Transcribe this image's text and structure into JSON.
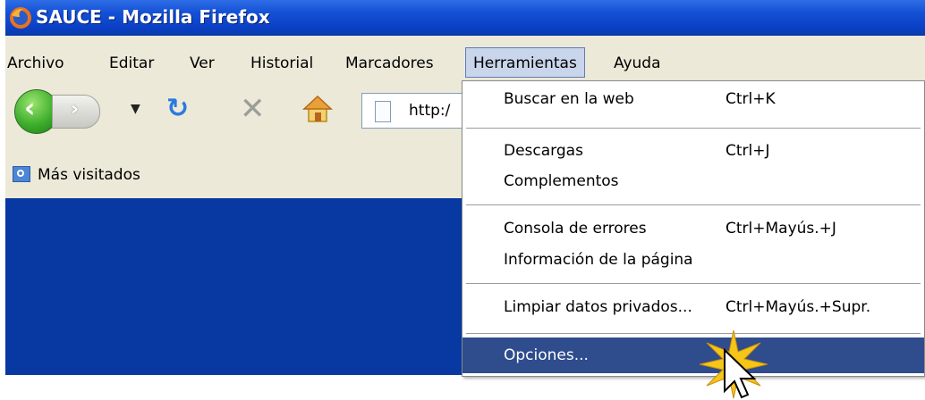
{
  "window": {
    "title": "SAUCE - Mozilla Firefox"
  },
  "menubar": {
    "items": [
      "Archivo",
      "Editar",
      "Ver",
      "Historial",
      "Marcadores",
      "Herramientas",
      "Ayuda"
    ],
    "active": "Herramientas"
  },
  "toolbar": {
    "url_text": "http:/"
  },
  "bookmarks": {
    "label": "Más visitados"
  },
  "tools_menu": {
    "items": [
      {
        "label": "Buscar en la web",
        "shortcut": "Ctrl+K"
      },
      {
        "label": "Descargas",
        "shortcut": "Ctrl+J"
      },
      {
        "label": "Complementos",
        "shortcut": ""
      },
      {
        "label": "Consola de errores",
        "shortcut": "Ctrl+Mayús.+J"
      },
      {
        "label": "Información de la página",
        "shortcut": ""
      },
      {
        "label": "Limpiar datos privados...",
        "shortcut": "Ctrl+Mayús.+Supr."
      },
      {
        "label": "Opciones...",
        "shortcut": ""
      }
    ],
    "highlighted": "Opciones..."
  },
  "colors": {
    "titlebar": "#0a3fc4",
    "content": "#0839a3",
    "menu_highlight": "#2f4c8c"
  }
}
